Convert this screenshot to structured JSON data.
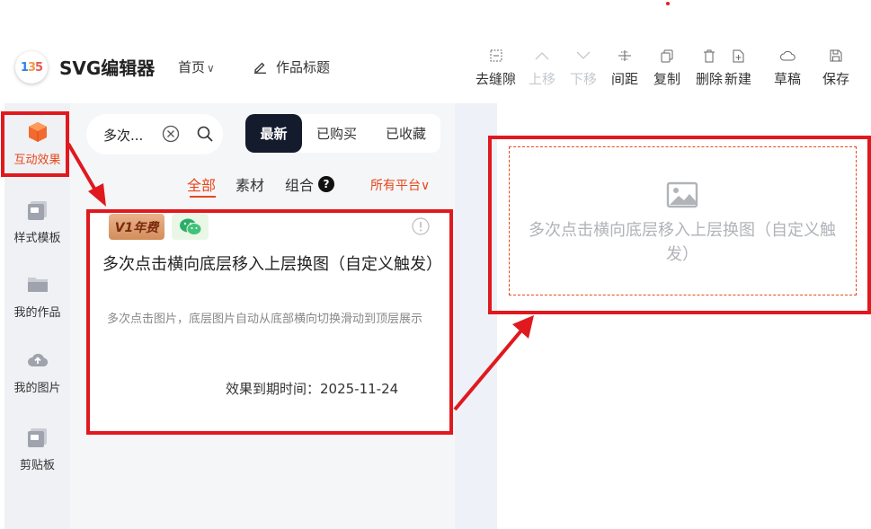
{
  "header": {
    "app_name": "SVG编辑器",
    "logo_text": "135",
    "home_menu": "首页",
    "work_title": "作品标题",
    "toolbar": [
      {
        "label": "去缝隙",
        "icon": "gap-icon",
        "enabled": true
      },
      {
        "label": "上移",
        "icon": "chevron-up-icon",
        "enabled": false
      },
      {
        "label": "下移",
        "icon": "chevron-down-icon",
        "enabled": false
      },
      {
        "label": "间距",
        "icon": "spacing-icon",
        "enabled": true
      },
      {
        "label": "复制",
        "icon": "copy-icon",
        "enabled": true
      },
      {
        "label": "删除",
        "icon": "trash-icon",
        "enabled": true
      },
      {
        "label": "新建",
        "icon": "new-file-icon",
        "enabled": true
      },
      {
        "label": "草稿",
        "icon": "cloud-icon",
        "enabled": true
      },
      {
        "label": "保存",
        "icon": "save-icon",
        "enabled": true
      }
    ]
  },
  "leftnav": {
    "items": [
      {
        "label": "互动效果",
        "icon": "cube-icon",
        "active": true
      },
      {
        "label": "样式模板",
        "icon": "template-icon",
        "active": false
      },
      {
        "label": "我的作品",
        "icon": "folder-icon",
        "active": false
      },
      {
        "label": "我的图片",
        "icon": "cloud-upload-icon",
        "active": false
      },
      {
        "label": "剪贴板",
        "icon": "clipboard-icon",
        "active": false
      }
    ]
  },
  "search": {
    "value": "多次..."
  },
  "filter": {
    "options": [
      "最新",
      "已购买",
      "已收藏"
    ],
    "selected": "最新"
  },
  "tabs": {
    "all": "全部",
    "material": "素材",
    "group": "组合",
    "group_badge": "?",
    "platform": "所有平台"
  },
  "card": {
    "badge_vip": "V1年费",
    "title": "多次点击横向底层移入上层换图（自定义触发）",
    "description": "多次点击图片，底层图片自动从底部横向切换滑动到顶层展示",
    "expiry": "效果到期时间：2025-11-24"
  },
  "canvas": {
    "placeholder_text": "多次点击横向底层移入上层换图（自定义触发）"
  },
  "colors": {
    "accent": "#e8471b",
    "annotation": "#e0191e",
    "dark_button": "#141b2d"
  }
}
